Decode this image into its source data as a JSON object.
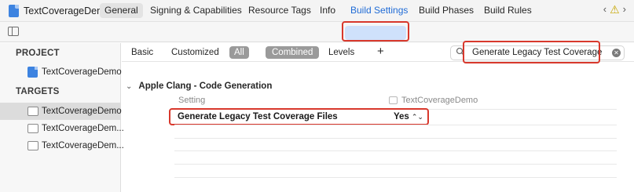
{
  "window": {
    "title": "TextCoverageDemo",
    "nav": {
      "back": "‹",
      "warning": "⚠",
      "forward": "›"
    }
  },
  "tabs": {
    "general": "General",
    "signing": "Signing & Capabilities",
    "resource_tags": "Resource Tags",
    "info": "Info",
    "build_settings": "Build Settings",
    "build_phases": "Build Phases",
    "build_rules": "Build Rules",
    "active": "Build Settings"
  },
  "sidebar": {
    "project_header": "PROJECT",
    "project_item": "TextCoverageDemo",
    "targets_header": "TARGETS",
    "targets": [
      {
        "label": "TextCoverageDemo",
        "selected": true
      },
      {
        "label": "TextCoverageDem...",
        "selected": false
      },
      {
        "label": "TextCoverageDem...",
        "selected": false
      }
    ]
  },
  "filter": {
    "basic": "Basic",
    "customized": "Customized",
    "all": "All",
    "combined": "Combined",
    "levels": "Levels",
    "add": "+"
  },
  "search": {
    "value": "Generate Legacy Test Coverage",
    "clear": "✕"
  },
  "content": {
    "group_chevron": "⌄",
    "group_title": "Apple Clang - Code Generation",
    "col_setting": "Setting",
    "col_target": "TextCoverageDemo",
    "rows": [
      {
        "name": "Generate Legacy Test Coverage Files",
        "value": "Yes",
        "stepper": "⌃⌄"
      }
    ]
  },
  "colors": {
    "highlight": "#d8382c",
    "accent": "#1f6bd6",
    "selected_tab_bg": "#cfe1fb"
  }
}
